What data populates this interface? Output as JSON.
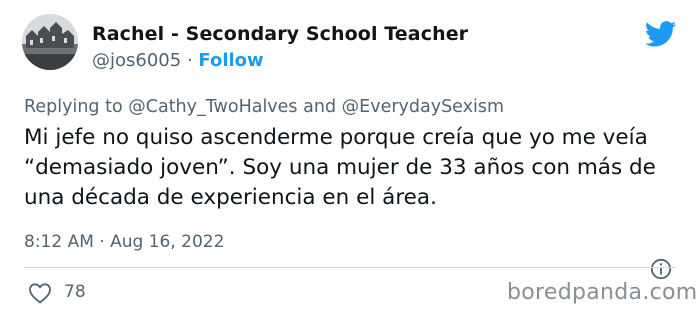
{
  "tweet": {
    "author_name": "Rachel - Secondary School Teacher",
    "handle": "@jos6005",
    "separator": "·",
    "follow_label": "Follow",
    "reply_prefix": "Replying to",
    "reply_mention_1": "@Cathy_TwoHalves",
    "reply_and": "and",
    "reply_mention_2": "@EverydaySexism",
    "text": "Mi jefe no quiso ascenderme porque creía que yo me veía “demasiado joven”. Soy una mujer de 33 años con más de una década de experiencia en el área.",
    "timestamp": "8:12 AM · Aug 16, 2022",
    "like_count": "78"
  },
  "watermark": "boredpanda.com",
  "icons": {
    "brand": "twitter-bird-icon",
    "info": "info-icon",
    "like": "heart-icon"
  },
  "colors": {
    "twitter_blue": "#1d9bf0",
    "secondary_text": "#536471",
    "primary_text": "#0f1419",
    "divider": "#cfd9de"
  }
}
